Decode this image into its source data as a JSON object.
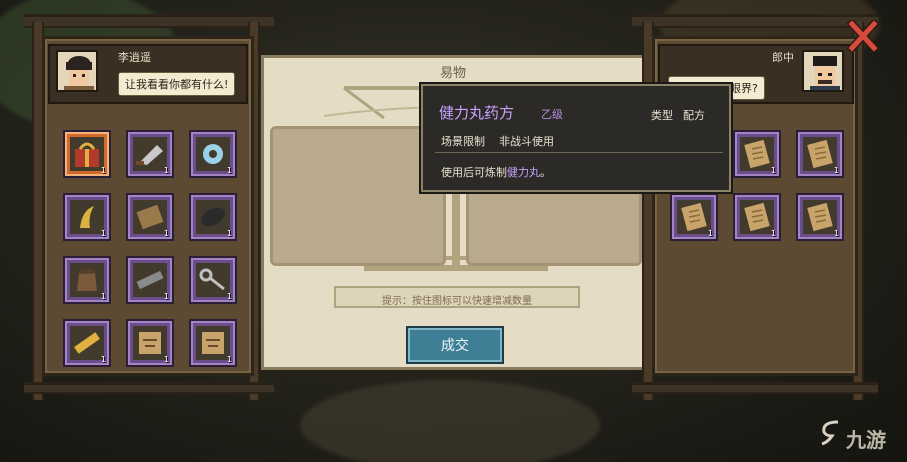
{
  "player": {
    "name": "李逍遥",
    "speech": "让我看看你都有什么!"
  },
  "merchant": {
    "name": "郎中",
    "speech": "是不是大开眼界?"
  },
  "trade": {
    "title": "易物",
    "hint": "提示：按住图标可以快速增减数量",
    "confirm_label": "成交"
  },
  "tooltip": {
    "item_name": "健力丸药方",
    "grade": "乙级",
    "type_label": "类型",
    "type_value": "配方",
    "restriction_label": "场景限制",
    "restriction_value": "非战斗使用",
    "desc_prefix": "使用后可炼制",
    "desc_item": "健力丸",
    "desc_suffix": "。"
  },
  "player_items": [
    {
      "icon": "gift-box-icon",
      "count": "1",
      "selected": true
    },
    {
      "icon": "cleaver-icon",
      "count": "1"
    },
    {
      "icon": "jade-ornament-icon",
      "count": "1"
    },
    {
      "icon": "herb-icon",
      "count": "1"
    },
    {
      "icon": "plaque-icon",
      "count": "1"
    },
    {
      "icon": "black-stone-icon",
      "count": "1"
    },
    {
      "icon": "jar-icon",
      "count": "1"
    },
    {
      "icon": "iron-bar-icon",
      "count": "1"
    },
    {
      "icon": "key-icon",
      "count": "1"
    },
    {
      "icon": "scroll-icon",
      "count": "1"
    },
    {
      "icon": "cloth-map-icon",
      "count": "1"
    },
    {
      "icon": "cloth-map-icon",
      "count": "1"
    }
  ],
  "merchant_items": [
    {
      "icon": "recipe-icon",
      "count": ""
    },
    {
      "icon": "recipe-icon",
      "count": "1"
    },
    {
      "icon": "recipe-icon",
      "count": "1"
    },
    {
      "icon": "recipe-icon",
      "count": "1"
    },
    {
      "icon": "recipe-icon",
      "count": "1"
    },
    {
      "icon": "recipe-icon",
      "count": "1"
    }
  ],
  "watermark": "九游",
  "colors": {
    "rare_slot": "#6a4e8c",
    "selected_slot": "#d26a2a",
    "tooltip_title": "#c9a1ff",
    "confirm_button": "#3f7f96"
  }
}
